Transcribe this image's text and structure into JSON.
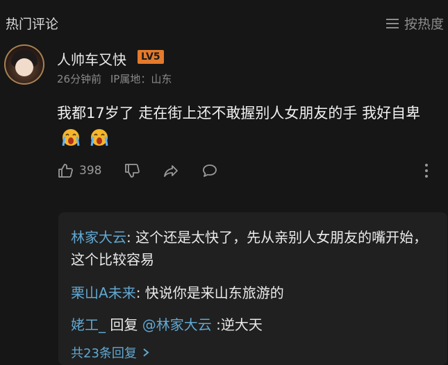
{
  "header": {
    "section_title": "热门评论",
    "sort_label": "按热度",
    "sort_icon": "menu-icon"
  },
  "comment": {
    "username": "人帅车又快",
    "level_badge": "LV5",
    "time": "26分钟前",
    "ip_location": "IP属地：山东",
    "text": "我都17岁了 走在街上还不敢握别人女朋友的手 我好自卑",
    "emojis": [
      "crying-emoji",
      "crying-emoji"
    ],
    "like_count": "398"
  },
  "replies": [
    {
      "user": "林家大云",
      "separator": ": ",
      "text": "这个还是太快了，先从亲别人女朋友的嘴开始，这个比较容易"
    },
    {
      "user": "栗山A未来",
      "separator": ": ",
      "text": "快说你是来山东旅游的"
    },
    {
      "user": "姥工_",
      "reply_word": " 回复 ",
      "mention": "@林家大云",
      "separator": " :",
      "text": "逆大天"
    }
  ],
  "more_replies": "共23条回复",
  "colors": {
    "background": "#161616",
    "reply_background": "#202020",
    "link_blue": "#61a8d2",
    "badge_orange": "#e47a2b"
  }
}
